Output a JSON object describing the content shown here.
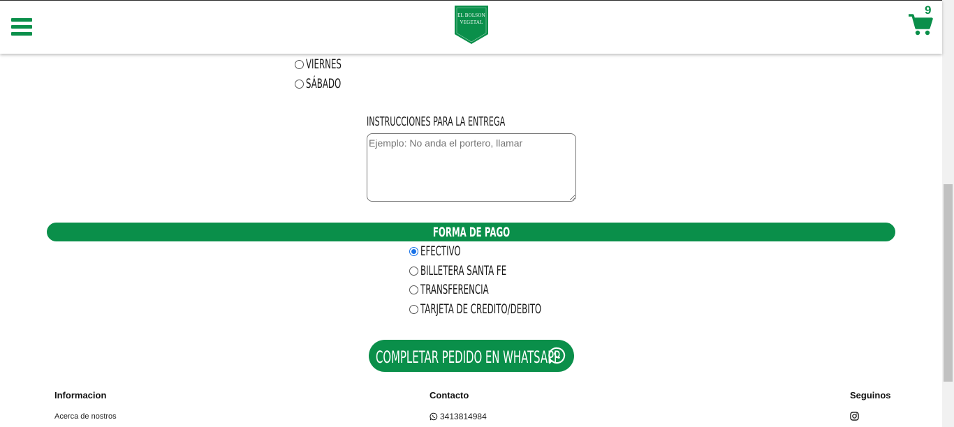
{
  "header": {
    "logo_line1": "EL BOLSON",
    "logo_line2": "VEGETAL",
    "cart_count": "9",
    "brand_color": "#0a8f4a"
  },
  "delivery_days": [
    {
      "label": "VIERNES",
      "checked": false
    },
    {
      "label": "SÁBADO",
      "checked": false
    }
  ],
  "instructions": {
    "label": "INSTRUCCIONES PARA LA ENTREGA",
    "placeholder": "Ejemplo: No anda el portero, llamar",
    "value": ""
  },
  "payment": {
    "title": "FORMA DE PAGO",
    "options": [
      {
        "label": "EFECTIVO",
        "checked": true
      },
      {
        "label": "BILLETERA SANTA FE",
        "checked": false
      },
      {
        "label": "TRANSFERENCIA",
        "checked": false
      },
      {
        "label": "TARJETA DE CREDITO/DEBITO",
        "checked": false
      }
    ]
  },
  "submit_button": {
    "label": "COMPLETAR PEDIDO EN WHATSAPP",
    "icon": "whatsapp-icon"
  },
  "footer": {
    "informacion": {
      "heading": "Informacion",
      "link": "Acerca de nostros"
    },
    "contacto": {
      "heading": "Contacto",
      "phone": "3413814984",
      "icon": "whatsapp-icon"
    },
    "seguinos": {
      "heading": "Seguinos",
      "icon": "instagram-icon"
    }
  }
}
